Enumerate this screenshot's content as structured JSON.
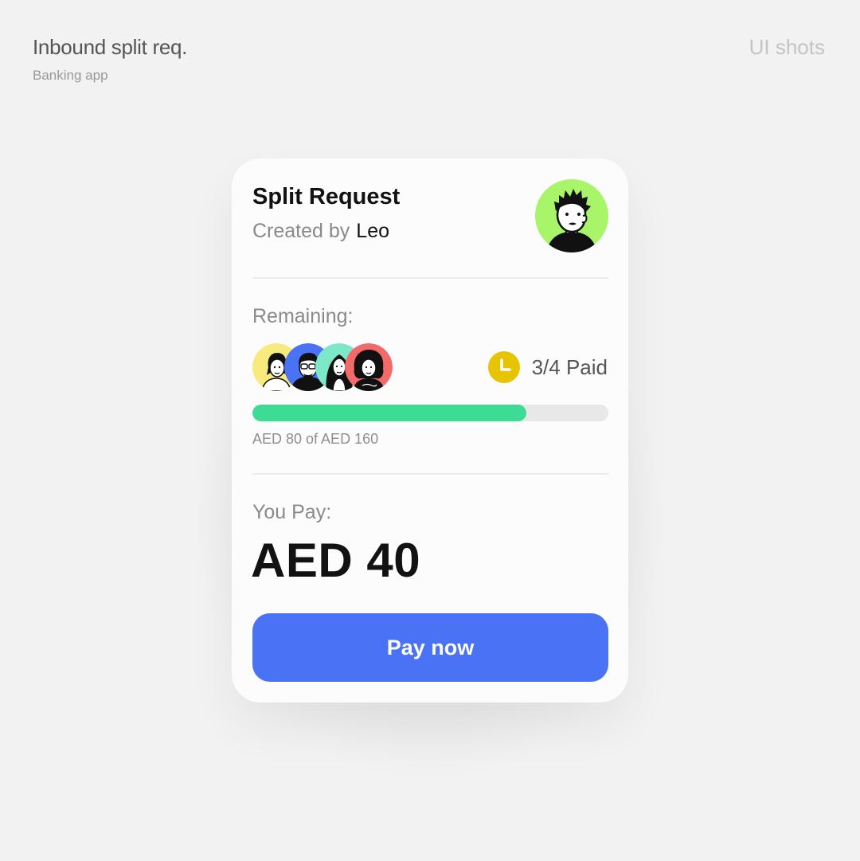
{
  "header": {
    "title": "Inbound split req.",
    "subtitle": "Banking app",
    "tag": "UI shots"
  },
  "card": {
    "title": "Split Request",
    "created_by_label": "Created by",
    "creator_name": "Leo",
    "remaining_label": "Remaining:",
    "participants": [
      {
        "avatar_color": "#f8ea7c"
      },
      {
        "avatar_color": "#4a72f5"
      },
      {
        "avatar_color": "#7de8c8"
      },
      {
        "avatar_color": "#f26a6a"
      }
    ],
    "paid_status": "3/4 Paid",
    "progress": {
      "collected": 80,
      "total": 160,
      "fraction": 0.77,
      "label": "AED 80 of AED 160"
    },
    "you_pay_label": "You Pay:",
    "you_pay_amount": "AED 40",
    "pay_button_label": "Pay now"
  },
  "colors": {
    "background": "#f2f2f2",
    "card": "#fcfcfc",
    "accent_button": "#4a72f5",
    "progress_fill": "#3ddc94",
    "progress_track": "#e8e8e8",
    "clock": "#e6c400",
    "creator_avatar": "#a8f56a"
  },
  "icons": {
    "creator_avatar": "person-avatar-icon",
    "clock": "clock-icon"
  }
}
